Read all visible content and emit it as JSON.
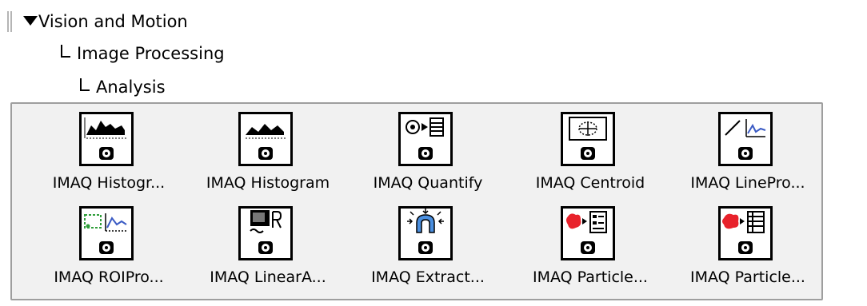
{
  "breadcrumb": [
    "Vision and Motion",
    "Image Processing",
    "Analysis"
  ],
  "palette": {
    "items": [
      {
        "label": "IMAQ Histogr...",
        "icon": "histograph-icon"
      },
      {
        "label": "IMAQ Histogram",
        "icon": "histogram-icon"
      },
      {
        "label": "IMAQ Quantify",
        "icon": "quantify-icon"
      },
      {
        "label": "IMAQ Centroid",
        "icon": "centroid-icon"
      },
      {
        "label": "IMAQ LinePro...",
        "icon": "line-profile-icon"
      },
      {
        "label": "IMAQ ROIPro...",
        "icon": "roi-profile-icon"
      },
      {
        "label": "IMAQ LinearA...",
        "icon": "linear-averages-icon"
      },
      {
        "label": "IMAQ Extract...",
        "icon": "extract-icon"
      },
      {
        "label": "IMAQ Particle...",
        "icon": "particle-analysis-report-icon"
      },
      {
        "label": "IMAQ Particle...",
        "icon": "particle-analysis-icon"
      }
    ]
  },
  "colors": {
    "particle": "#e8222b",
    "roi": "#2f9e3a",
    "profile": "#3b5bc4",
    "grip": "#b5b5b5",
    "panel": "#f1f1f1"
  }
}
